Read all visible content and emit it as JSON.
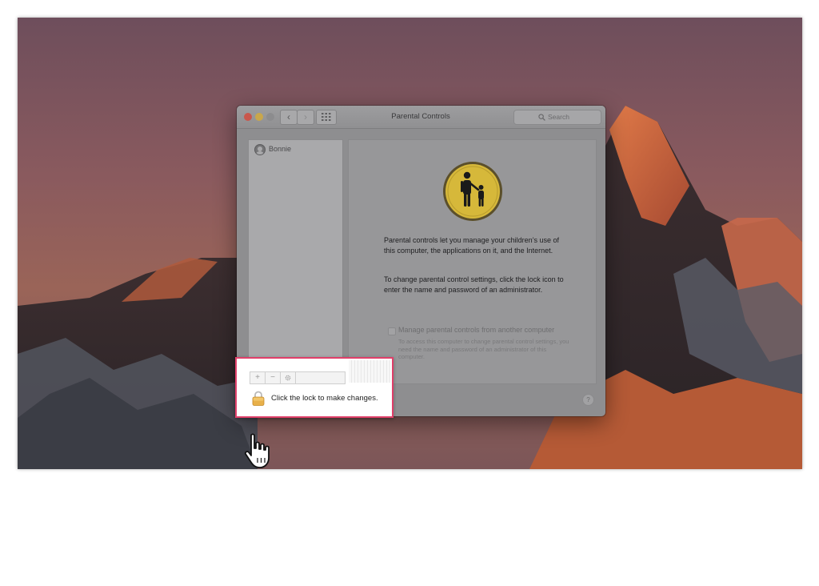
{
  "window": {
    "title": "Parental Controls",
    "search_placeholder": "Search"
  },
  "sidebar": {
    "users": [
      {
        "name": "Bonnie"
      }
    ]
  },
  "sidebar_toolbar": {
    "add_label": "+",
    "remove_label": "−"
  },
  "main": {
    "intro_text": "Parental controls let you manage your children’s use of this computer, the applications on it, and the Internet.",
    "lock_instructions": "To change parental control settings, click the lock icon to enter the name and password of an administrator.",
    "remote_option_label": "Manage parental controls from another computer",
    "remote_option_note": "To access this computer to change parental control settings, you need the name and password of an administrator of this computer."
  },
  "help_label": "?",
  "lock": {
    "label": "Click the lock to make changes."
  },
  "colors": {
    "highlight_border": "#e0406a",
    "icon_gold": "#d6b83a",
    "close_light": "#c9574c",
    "minimize_light": "#c9a74b"
  },
  "icons": {
    "window_close": "traffic-light-close",
    "window_minimize": "traffic-light-minimize",
    "window_zoom": "traffic-light-zoom",
    "nav_back": "chevron-left-icon",
    "nav_forward": "chevron-right-icon",
    "show_all": "grid-icon",
    "search": "magnifier-icon",
    "user": "user-avatar-icon",
    "preference_pane": "parent-child-icon",
    "settings": "gear-icon",
    "lock": "padlock-icon",
    "pointer": "hand-pointer-icon"
  }
}
